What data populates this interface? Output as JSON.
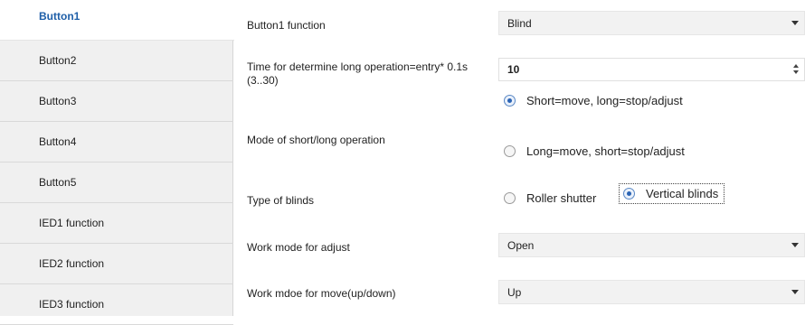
{
  "sidebar": {
    "items": [
      {
        "label": "Button1"
      },
      {
        "label": "Button2"
      },
      {
        "label": "Button3"
      },
      {
        "label": "Button4"
      },
      {
        "label": "Button5"
      },
      {
        "label": "IED1 function"
      },
      {
        "label": "IED2 function"
      },
      {
        "label": "IED3 function"
      }
    ],
    "active_index": 0
  },
  "main": {
    "button_function": {
      "label": "Button1 function",
      "value": "Blind"
    },
    "long_operation_time": {
      "label_line1": "Time for determine long operation=entry* 0.1s",
      "label_line2": "(3..30)",
      "value": "10"
    },
    "mode": {
      "label": "Mode of short/long operation",
      "options": [
        "Short=move, long=stop/adjust",
        "Long=move, short=stop/adjust"
      ],
      "selected": 0
    },
    "blind_type": {
      "label": "Type of blinds",
      "options": [
        "Roller shutter",
        "Vertical blinds"
      ],
      "selected": 1
    },
    "adjust_mode": {
      "label": "Work mode for adjust",
      "value": "Open"
    },
    "move_mode": {
      "label": "Work mdoe for move(up/down)",
      "value": "Up"
    }
  },
  "colors": {
    "active_item": "#1f5fa8",
    "sidebar_bg": "#f0f0f0",
    "dropdown_bg": "#f2f2f2"
  }
}
